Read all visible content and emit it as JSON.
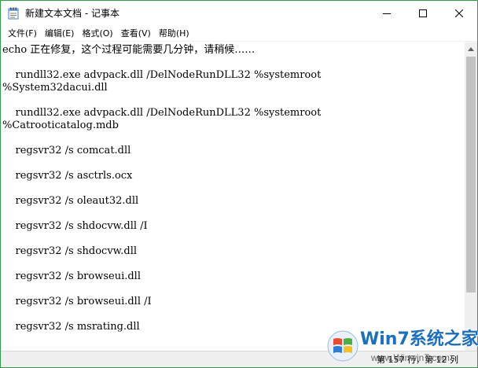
{
  "window": {
    "title": "新建文本文档 - 记事本",
    "border_color": "#2ea043"
  },
  "menu": [
    {
      "label": "文件(F)"
    },
    {
      "label": "编辑(E)"
    },
    {
      "label": "格式(O)"
    },
    {
      "label": "查看(V)"
    },
    {
      "label": "帮助(H)"
    }
  ],
  "editor": {
    "lines": [
      "echo 正在修复，这个过程可能需要几分钟，请稍候……",
      "    rundll32.exe advpack.dll /DelNodeRunDLL32 %systemroot",
      "%System32dacui.dll",
      "    rundll32.exe advpack.dll /DelNodeRunDLL32 %systemroot",
      "%Catrooticatalog.mdb",
      "    regsvr32 /s comcat.dll",
      "    regsvr32 /s asctrls.ocx",
      "    regsvr32 /s oleaut32.dll",
      "    regsvr32 /s shdocvw.dll /I",
      "    regsvr32 /s shdocvw.dll",
      "    regsvr32 /s browseui.dll",
      "    regsvr32 /s browseui.dll /I",
      "    regsvr32 /s msrating.dll"
    ]
  },
  "status": {
    "position": "第 157 行，第 12 列"
  },
  "watermark": {
    "brand": "Win7系统之家",
    "url": "www.Winwin7.com"
  },
  "icons": {
    "app": "notepad-icon",
    "minimize": "minimize-icon",
    "maximize": "maximize-icon",
    "close": "close-icon",
    "scroll_up": "chevron-up-icon",
    "scroll_down": "chevron-down-icon",
    "watermark_logo": "windows-logo-icon"
  }
}
